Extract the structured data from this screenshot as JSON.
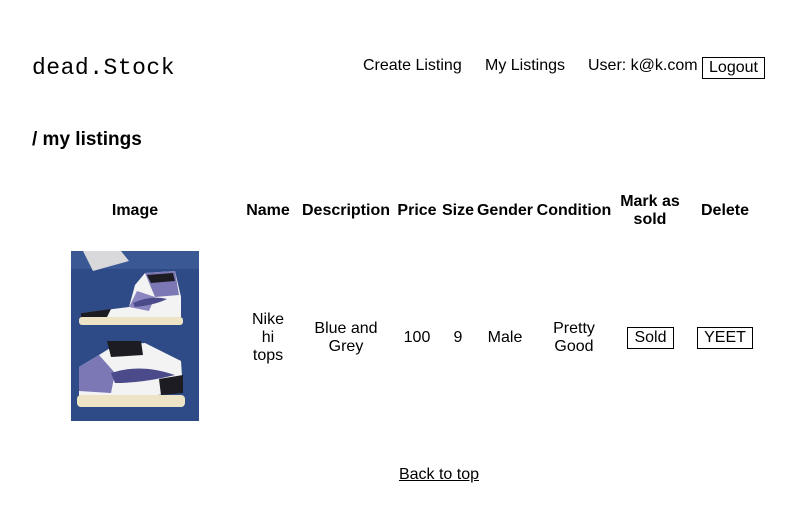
{
  "brand": {
    "logo": "dead.Stock"
  },
  "nav": {
    "create_listing": "Create Listing",
    "my_listings": "My Listings",
    "user_label": "User: k@k.com",
    "logout": "Logout"
  },
  "page": {
    "title": "/ my listings"
  },
  "table": {
    "headers": {
      "image": "Image",
      "name": "Name",
      "description": "Description",
      "price": "Price",
      "size": "Size",
      "gender": "Gender",
      "condition": "Condition",
      "mark_sold_line1": "Mark as",
      "mark_sold_line2": "sold",
      "delete": "Delete"
    },
    "rows": [
      {
        "name_lines": [
          "Nike",
          "hi",
          "tops"
        ],
        "description_lines": [
          "Blue and",
          "Grey"
        ],
        "price": "100",
        "size": "9",
        "gender": "Male",
        "condition_lines": [
          "Pretty",
          "Good"
        ],
        "sold_button": "Sold",
        "delete_button": "YEET"
      }
    ]
  },
  "footer": {
    "back_to_top": "Back to top"
  },
  "colors": {
    "text": "#000000",
    "background": "#ffffff",
    "photo_bg": "#2f4b87"
  }
}
